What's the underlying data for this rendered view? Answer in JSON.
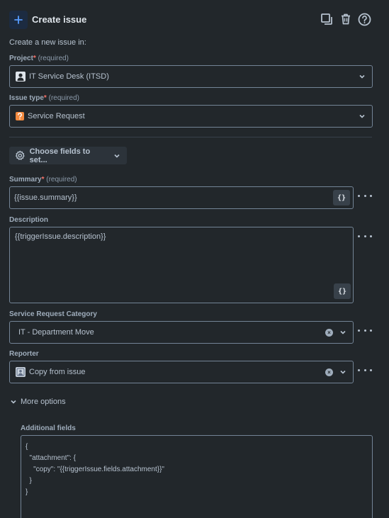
{
  "header": {
    "title": "Create issue"
  },
  "intro": "Create a new issue in:",
  "required_text": "(required)",
  "project": {
    "label": "Project",
    "value": "IT Service Desk (ITSD)"
  },
  "issue_type": {
    "label": "Issue type",
    "value": "Service Request"
  },
  "choose_fields": {
    "label": "Choose fields to set..."
  },
  "summary": {
    "label": "Summary",
    "value": "{{issue.summary}}",
    "brace_label": "{}"
  },
  "description": {
    "label": "Description",
    "value": "{{triggerIssue.description}}",
    "brace_label": "{}"
  },
  "service_request_category": {
    "label": "Service Request Category",
    "value": "IT - Department Move"
  },
  "reporter": {
    "label": "Reporter",
    "value": "Copy from issue"
  },
  "more_options": {
    "label": "More options"
  },
  "additional_fields": {
    "label": "Additional fields",
    "lines": [
      "{",
      "  \"attachment\": {",
      "    \"copy\": \"{{triggerIssue.fields.attachment}}\"",
      "  }",
      "}"
    ]
  },
  "colors": {
    "background": "#22272b",
    "accent": "#579dff",
    "required_star": "#f87168",
    "border": "#738496",
    "issue_type_icon": "#f38a3f"
  }
}
